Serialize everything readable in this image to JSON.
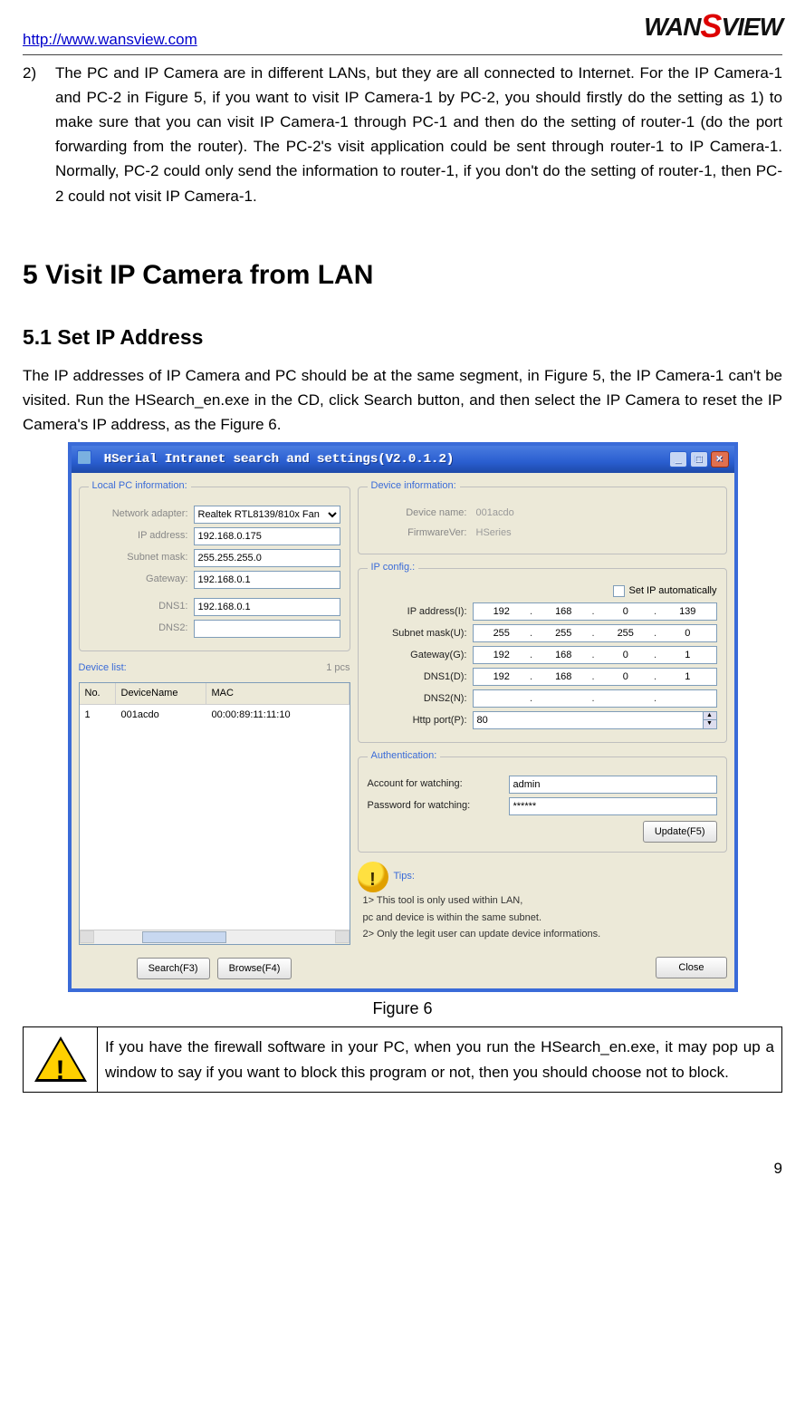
{
  "header": {
    "url": "http://www.wansview.com",
    "logo_wan": "WAN",
    "logo_s": "S",
    "logo_view": "VIEW"
  },
  "item2": {
    "num": "2)",
    "text": "The PC and IP Camera are in different LANs, but they are all connected to Internet. For the IP Camera-1 and PC-2 in Figure 5, if you want to visit IP Camera-1 by PC-2, you should firstly do the setting as 1) to make sure that you can visit IP Camera-1 through PC-1 and then do the setting of router-1 (do the port forwarding from the router). The PC-2's visit application could be sent through router-1 to IP Camera-1. Normally, PC-2 could only send the information to router-1, if you don't do the setting of router-1, then PC-2 could not visit IP Camera-1."
  },
  "h1": "5   Visit IP Camera from LAN",
  "h2": "5.1  Set IP Address",
  "para": "The IP addresses of IP Camera and PC should be at the same segment, in Figure 5, the IP Camera-1 can't be visited. Run the HSearch_en.exe in the CD, click Search button, and then select the IP Camera to reset the IP Camera's IP address, as the Figure 6.",
  "shot": {
    "title": "HSerial Intranet search and settings(V2.0.1.2)",
    "localpc": {
      "legend": "Local PC information:",
      "network_adapter_label": "Network adapter:",
      "network_adapter_value": "Realtek RTL8139/810x Fan",
      "ip_label": "IP address:",
      "ip_value": "192.168.0.175",
      "subnet_label": "Subnet mask:",
      "subnet_value": "255.255.255.0",
      "gateway_label": "Gateway:",
      "gateway_value": "192.168.0.1",
      "dns1_label": "DNS1:",
      "dns1_value": "192.168.0.1",
      "dns2_label": "DNS2:",
      "dns2_value": ""
    },
    "devlist": {
      "legend": "Device list:",
      "count": "1 pcs",
      "col_no": "No.",
      "col_name": "DeviceName",
      "col_mac": "MAC",
      "row_no": "1",
      "row_name": "001acdo",
      "row_mac": "00:00:89:11:11:10"
    },
    "devinfo": {
      "legend": "Device information:",
      "devname_label": "Device name:",
      "devname_value": "001acdo",
      "fw_label": "FirmwareVer:",
      "fw_value": "HSeries"
    },
    "ipconfig": {
      "legend": "IP config.:",
      "auto_label": "Set IP automatically",
      "ip_label": "IP address(I):",
      "ip": [
        "192",
        "168",
        "0",
        "139"
      ],
      "subnet_label": "Subnet mask(U):",
      "subnet": [
        "255",
        "255",
        "255",
        "0"
      ],
      "gw_label": "Gateway(G):",
      "gw": [
        "192",
        "168",
        "0",
        "1"
      ],
      "dns1_label": "DNS1(D):",
      "dns1": [
        "192",
        "168",
        "0",
        "1"
      ],
      "dns2_label": "DNS2(N):",
      "dns2": [
        "",
        "",
        "",
        ""
      ],
      "http_label": "Http port(P):",
      "http_value": "80"
    },
    "auth": {
      "legend": "Authentication:",
      "acc_label": "Account for watching:",
      "acc_value": "admin",
      "pwd_label": "Password for watching:",
      "pwd_value": "******",
      "update_btn": "Update(F5)"
    },
    "tips": {
      "legend": "Tips:",
      "l1": "1> This tool is only used within LAN,",
      "l2": "      pc and device is within the same subnet.",
      "l3": "2> Only the legit user can update  device informations."
    },
    "btns": {
      "search": "Search(F3)",
      "browse": "Browse(F4)",
      "close": "Close"
    }
  },
  "figcap": "Figure 6",
  "warn": "If you have the firewall software in your PC, when you run the HSearch_en.exe, it may pop up a window to say if you want to block this program or not, then you should choose not to block.",
  "pagenum": "9"
}
